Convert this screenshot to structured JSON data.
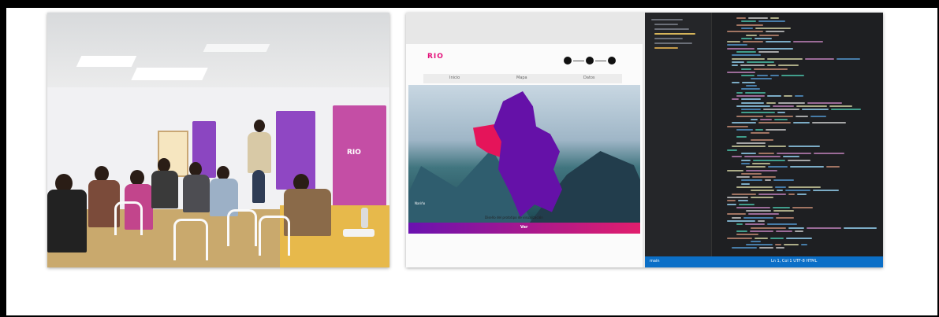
{
  "photo_workshop": {
    "banners": [
      {
        "label": "",
        "color": "#8b46c1"
      },
      {
        "label": "",
        "color": "#8f47c3"
      },
      {
        "label": "RIO",
        "color": "#c44ea5"
      }
    ]
  },
  "photo_screen": {
    "site": {
      "logo": "RIO",
      "nav": [
        "Inicio",
        "Mapa",
        "Datos"
      ],
      "hero_caption": "Nariño",
      "footer_text": "Diseño del prototipo de visualización",
      "footer_button": "Ver",
      "region_main_color": "#6511a8",
      "region_side_color": "#e5145a"
    },
    "editor": {
      "status_left": "main",
      "status_right": "Ln 1, Col 1  UTF-8  HTML"
    }
  }
}
